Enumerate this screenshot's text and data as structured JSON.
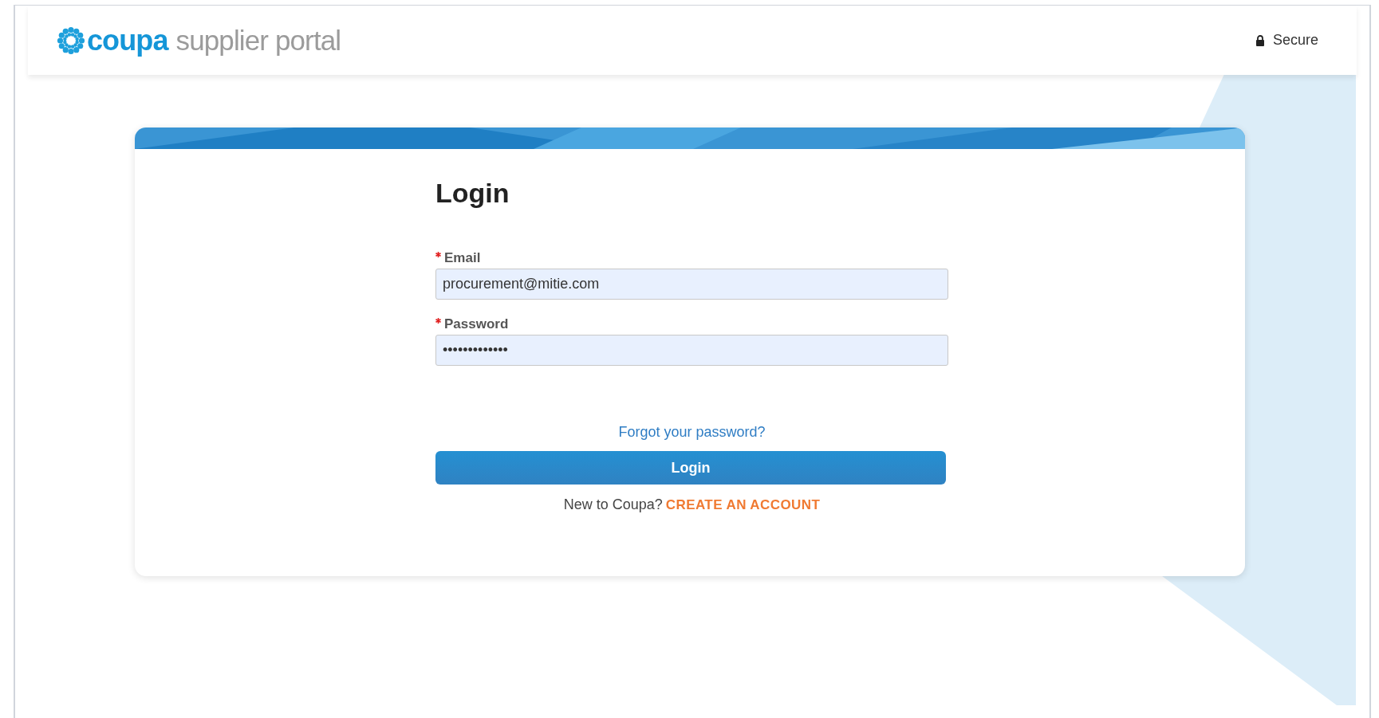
{
  "header": {
    "logo_brand": "coupa",
    "logo_product": "supplier portal",
    "secure_label": "Secure"
  },
  "login_card": {
    "title": "Login",
    "fields": [
      {
        "label": "Email",
        "required": true,
        "value": "procurement@mitie.com"
      },
      {
        "label": "Password",
        "required": true,
        "value": "•••••••••••••"
      }
    ],
    "forgot_link": "Forgot your password?",
    "submit_button": "Login",
    "signup_prompt": "New to Coupa?",
    "signup_link": "CREATE AN ACCOUNT"
  }
}
